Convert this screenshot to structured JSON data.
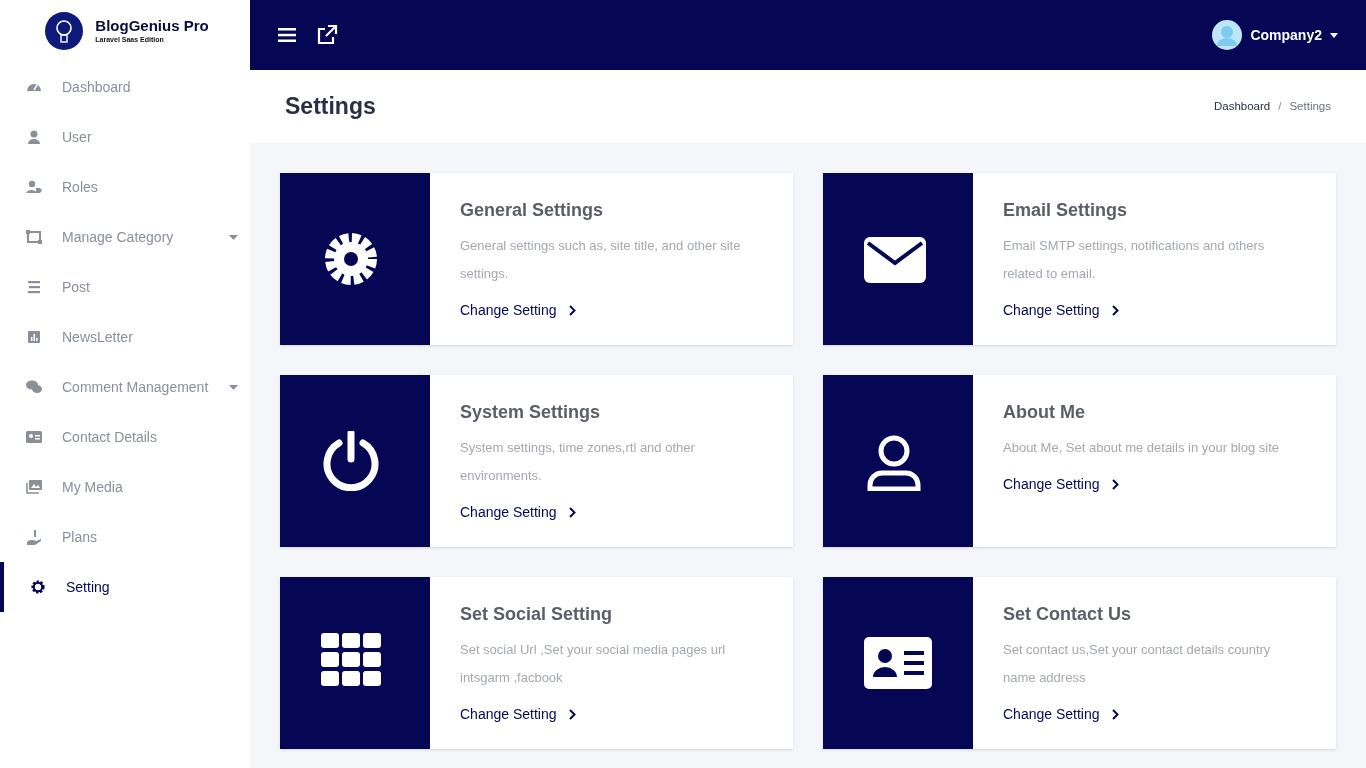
{
  "brand": {
    "name": "BlogGenius Pro",
    "tagline": "Laravel Saas Edition"
  },
  "sidebar": {
    "items": [
      {
        "label": "Dashboard",
        "has_submenu": false,
        "selected": false
      },
      {
        "label": "User",
        "has_submenu": false,
        "selected": false
      },
      {
        "label": "Roles",
        "has_submenu": false,
        "selected": false
      },
      {
        "label": "Manage Category",
        "has_submenu": true,
        "selected": false
      },
      {
        "label": "Post",
        "has_submenu": false,
        "selected": false
      },
      {
        "label": "NewsLetter",
        "has_submenu": false,
        "selected": false
      },
      {
        "label": "Comment Management",
        "has_submenu": true,
        "selected": false
      },
      {
        "label": "Contact Details",
        "has_submenu": false,
        "selected": false
      },
      {
        "label": "My Media",
        "has_submenu": false,
        "selected": false
      },
      {
        "label": "Plans",
        "has_submenu": false,
        "selected": false
      },
      {
        "label": "Setting",
        "has_submenu": false,
        "selected": true
      }
    ]
  },
  "topbar": {
    "user": "Company2"
  },
  "page": {
    "title": "Settings",
    "breadcrumb": [
      "Dashboard",
      "Settings"
    ],
    "breadcrumb_separator": "/"
  },
  "cards": [
    {
      "title": "General Settings",
      "description": "General settings such as, site title, and other site settings.",
      "link": "Change Setting"
    },
    {
      "title": "Email Settings",
      "description": "Email SMTP settings, notifications and others related to email.",
      "link": "Change Setting"
    },
    {
      "title": "System Settings",
      "description": "System settings, time zones,rtl and other environments.",
      "link": "Change Setting"
    },
    {
      "title": "About Me",
      "description": "About Me, Set about me details in your blog site",
      "link": "Change Setting"
    },
    {
      "title": "Set Social Setting",
      "description": "Set social Url ,Set your social media pages url intsgarm ,facbook",
      "link": "Change Setting"
    },
    {
      "title": "Set Contact Us",
      "description": "Set contact us,Set your contact details country name address",
      "link": "Change Setting"
    }
  ]
}
